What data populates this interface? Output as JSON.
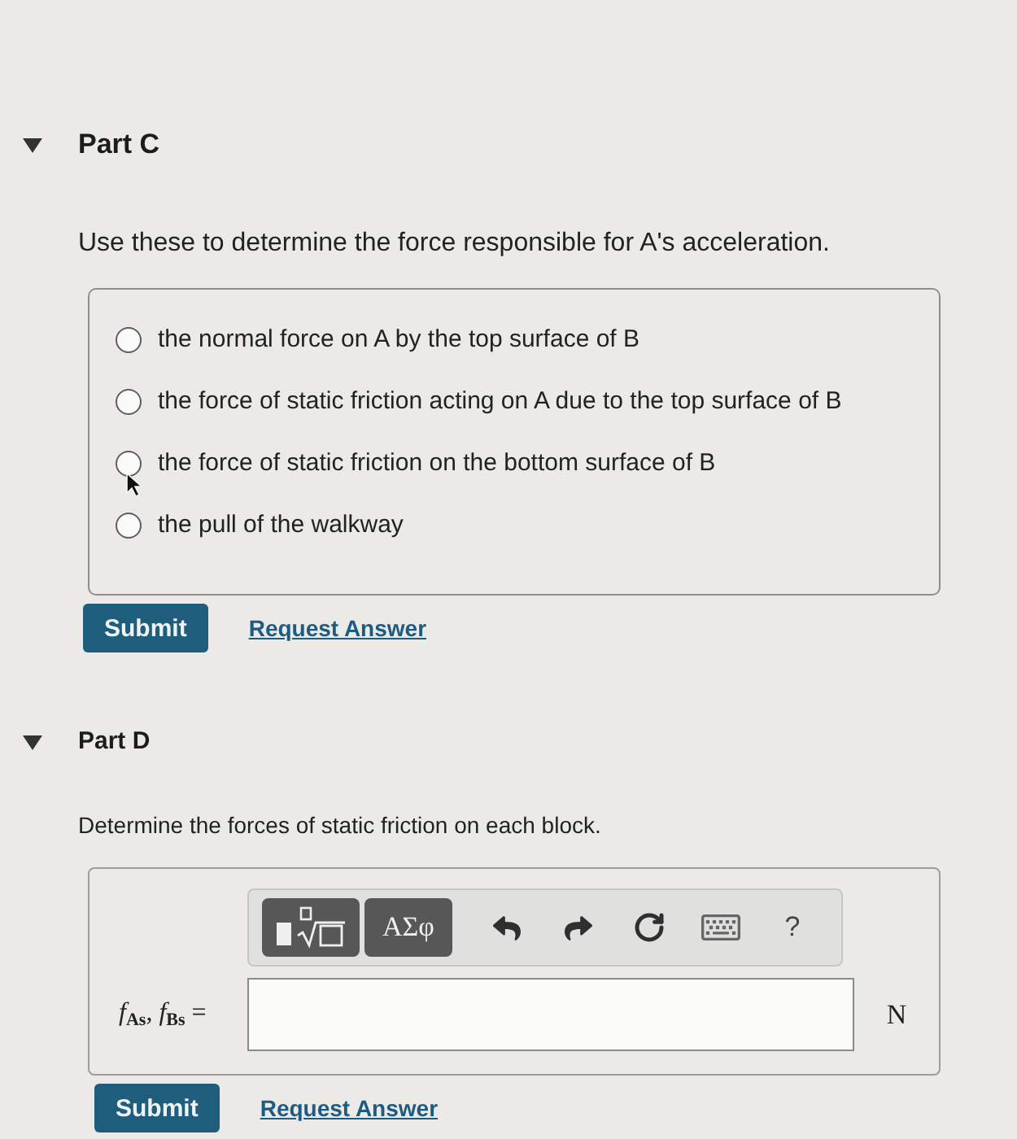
{
  "parts": [
    {
      "title": "Part C",
      "expanded": true,
      "prompt": "Use these to determine the force responsible for A's acceleration.",
      "answer": {
        "kind": "choice",
        "options": [
          {
            "label": "the normal force on A by the top surface of B",
            "selected": false
          },
          {
            "label": "the force of static friction acting on A due to the top surface of B",
            "selected": false
          },
          {
            "label": "the force of static friction on the bottom surface of B",
            "selected": false
          },
          {
            "label": "the pull of the walkway",
            "selected": false
          }
        ]
      },
      "actions": {
        "submit": "Submit",
        "request_answer": "Request Answer"
      }
    },
    {
      "title": "Part D",
      "expanded": true,
      "prompt": "Determine the forces of static friction on each block.",
      "answer": {
        "kind": "math",
        "toolbar": {
          "symbols": "ΑΣφ",
          "help": "?"
        },
        "label": "*f*$_{As}$, *f*$_{Bs}$ =",
        "unit": "N"
      },
      "actions": {
        "submit": "Submit",
        "request_answer": "Request Answer"
      }
    }
  ]
}
